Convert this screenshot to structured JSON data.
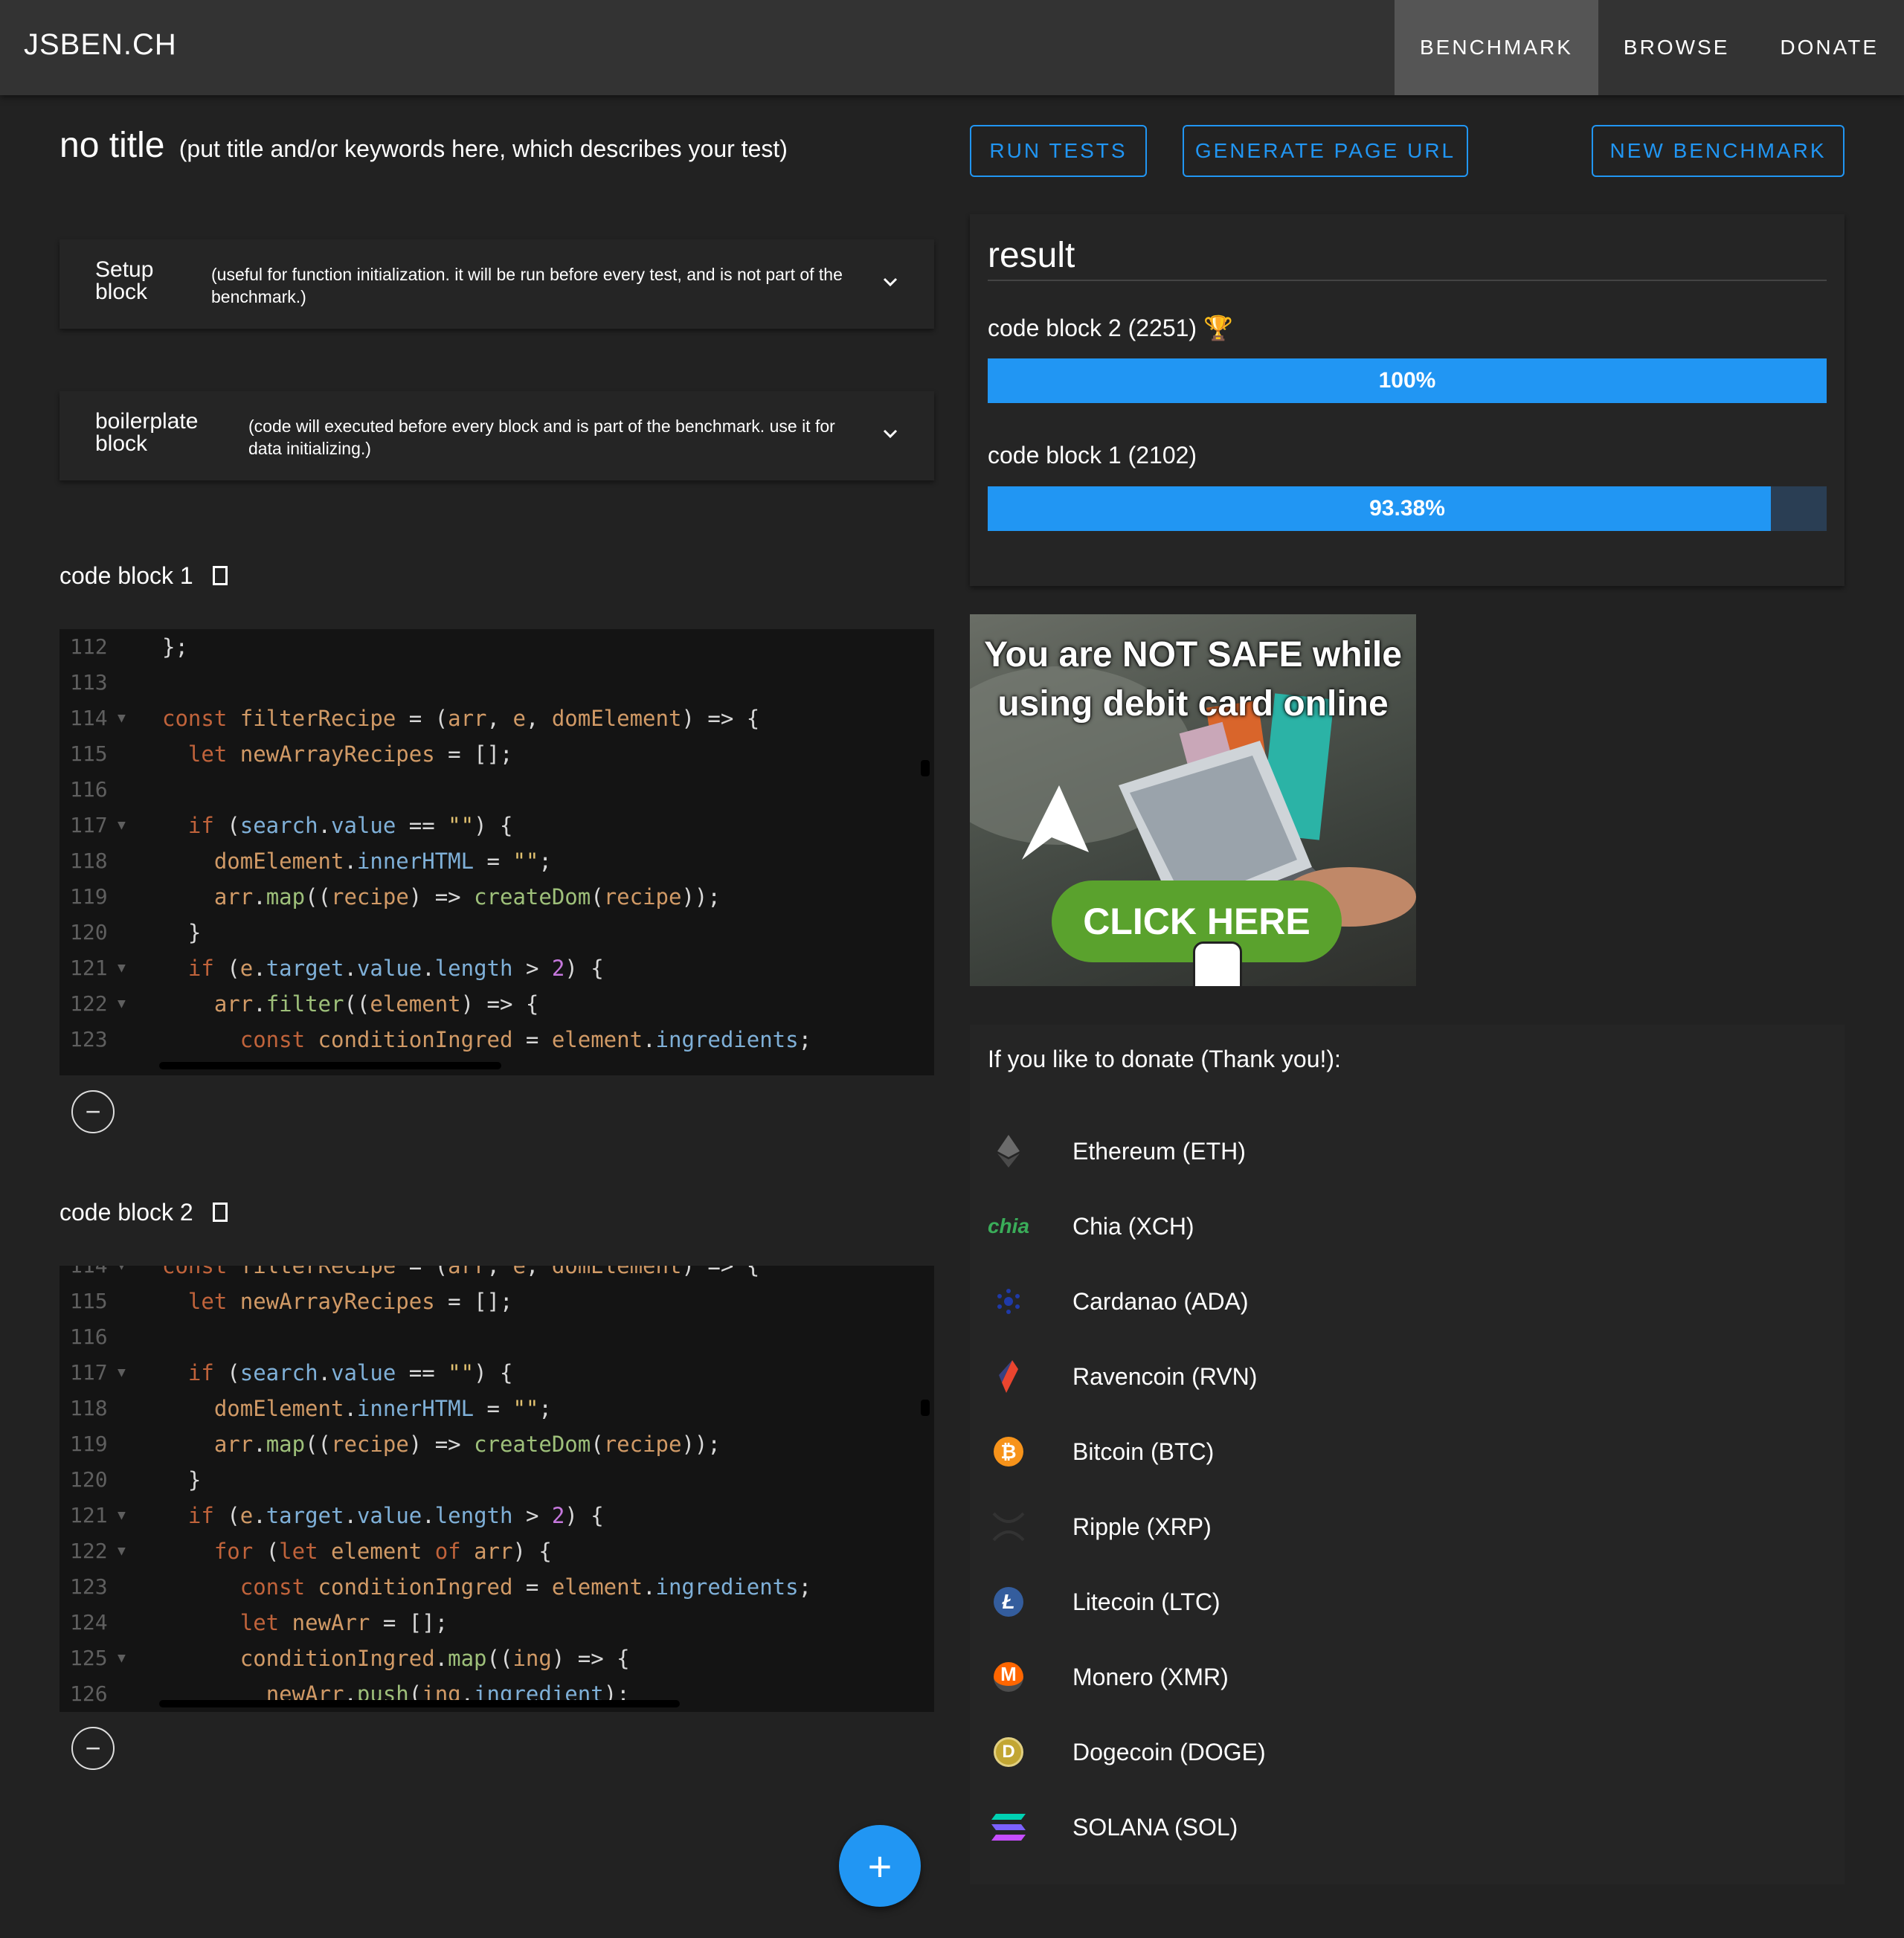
{
  "brand": "JSBEN.CH",
  "nav": [
    {
      "label": "BENCHMARK",
      "active": true
    },
    {
      "label": "BROWSE",
      "active": false
    },
    {
      "label": "DONATE",
      "active": false
    }
  ],
  "title": {
    "main": "no title",
    "hint": "(put title and/or keywords here, which describes your test)"
  },
  "buttons": {
    "run": "RUN TESTS",
    "generate": "GENERATE PAGE URL",
    "new": "NEW BENCHMARK"
  },
  "setup": {
    "title": "Setup block",
    "desc": "(useful for function initialization. it will be run before every test, and is not part of the benchmark.)"
  },
  "boilerplate": {
    "title": "boilerplate block",
    "desc": "(code will executed before every block and is part of the benchmark. use it for data initializing.)"
  },
  "code_block_1": {
    "label": "code block 1",
    "lines": [
      {
        "n": "112",
        "fold": "",
        "code": "};"
      },
      {
        "n": "113",
        "fold": "",
        "code": ""
      },
      {
        "n": "114",
        "fold": "▼",
        "code": "const filterRecipe = (arr, e, domElement) => {"
      },
      {
        "n": "115",
        "fold": "",
        "code": "  let newArrayRecipes = [];"
      },
      {
        "n": "116",
        "fold": "",
        "code": ""
      },
      {
        "n": "117",
        "fold": "▼",
        "code": "  if (search.value == \"\") {"
      },
      {
        "n": "118",
        "fold": "",
        "code": "    domElement.innerHTML = \"\";"
      },
      {
        "n": "119",
        "fold": "",
        "code": "    arr.map((recipe) => createDom(recipe));"
      },
      {
        "n": "120",
        "fold": "",
        "code": "  }"
      },
      {
        "n": "121",
        "fold": "▼",
        "code": "  if (e.target.value.length > 2) {"
      },
      {
        "n": "122",
        "fold": "▼",
        "code": "    arr.filter((element) => {"
      },
      {
        "n": "123",
        "fold": "",
        "code": "      const conditionIngred = element.ingredients;"
      }
    ]
  },
  "code_block_2": {
    "label": "code block 2",
    "lines": [
      {
        "n": "114",
        "fold": "▼",
        "code": "const filterRecipe = (arr, e, domElement) => {"
      },
      {
        "n": "115",
        "fold": "",
        "code": "  let newArrayRecipes = [];"
      },
      {
        "n": "116",
        "fold": "",
        "code": ""
      },
      {
        "n": "117",
        "fold": "▼",
        "code": "  if (search.value == \"\") {"
      },
      {
        "n": "118",
        "fold": "",
        "code": "    domElement.innerHTML = \"\";"
      },
      {
        "n": "119",
        "fold": "",
        "code": "    arr.map((recipe) => createDom(recipe));"
      },
      {
        "n": "120",
        "fold": "",
        "code": "  }"
      },
      {
        "n": "121",
        "fold": "▼",
        "code": "  if (e.target.value.length > 2) {"
      },
      {
        "n": "122",
        "fold": "▼",
        "code": "    for (let element of arr) {"
      },
      {
        "n": "123",
        "fold": "",
        "code": "      const conditionIngred = element.ingredients;"
      },
      {
        "n": "124",
        "fold": "",
        "code": "      let newArr = [];"
      },
      {
        "n": "125",
        "fold": "▼",
        "code": "      conditionIngred.map((ing) => {"
      },
      {
        "n": "126",
        "fold": "",
        "code": "        newArr.push(ing.ingredient);"
      }
    ]
  },
  "result": {
    "title": "result",
    "entries": [
      {
        "label": "code block 2 (2251)",
        "trophy": true,
        "percent_text": "100%",
        "fraction": 1.0
      },
      {
        "label": "code block 1 (2102)",
        "trophy": false,
        "percent_text": "93.38%",
        "fraction": 0.9338
      }
    ]
  },
  "ad": {
    "headline": "You are NOT SAFE while using debit card online",
    "cta": "CLICK HERE"
  },
  "donate": {
    "heading": "If you like to donate (Thank you!):",
    "coins": [
      {
        "label": "Ethereum (ETH)",
        "icon": "ethereum-icon"
      },
      {
        "label": "Chia (XCH)",
        "icon": "chia-icon"
      },
      {
        "label": "Cardanao (ADA)",
        "icon": "cardano-icon"
      },
      {
        "label": "Ravencoin (RVN)",
        "icon": "ravencoin-icon"
      },
      {
        "label": "Bitcoin (BTC)",
        "icon": "bitcoin-icon"
      },
      {
        "label": "Ripple (XRP)",
        "icon": "ripple-icon"
      },
      {
        "label": "Litecoin (LTC)",
        "icon": "litecoin-icon"
      },
      {
        "label": "Monero (XMR)",
        "icon": "monero-icon"
      },
      {
        "label": "Dogecoin (DOGE)",
        "icon": "dogecoin-icon"
      },
      {
        "label": "SOLANA (SOL)",
        "icon": "solana-icon"
      }
    ]
  },
  "colors": {
    "accent": "#2196f3",
    "background": "#222222",
    "topbar": "#333333",
    "ad_button": "#5aa22d"
  }
}
